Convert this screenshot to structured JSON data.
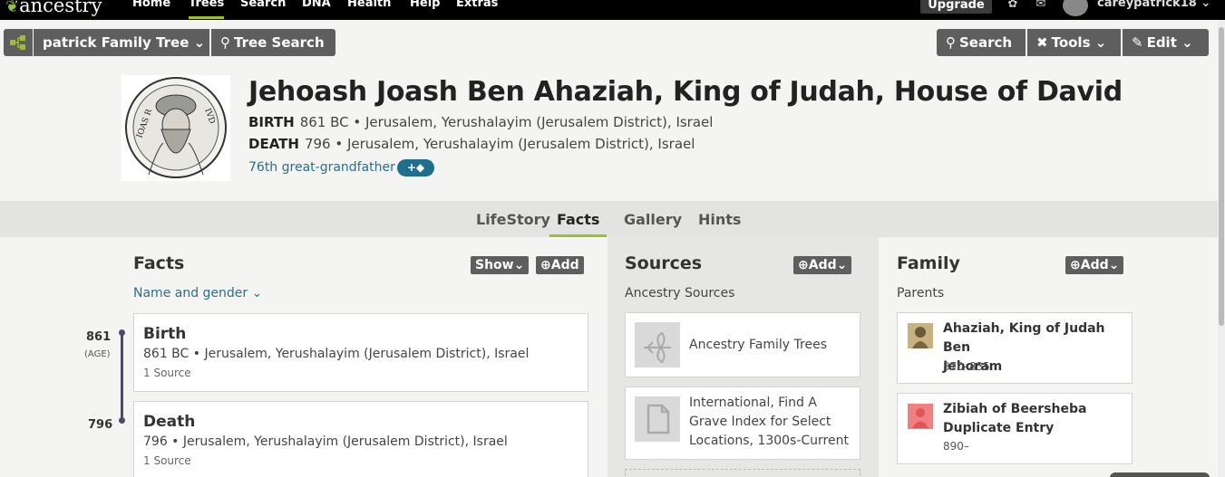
{
  "topnav": {
    "logo": "ancestry",
    "items": [
      "Home",
      "Trees",
      "Search",
      "DNA",
      "Health",
      "Help",
      "Extras"
    ],
    "active": "Trees",
    "upgrade": "Upgrade",
    "username": "careypatrick18"
  },
  "toolbar": {
    "tree_name": "patrick Family Tree",
    "tree_search": "Tree Search",
    "search": "Search",
    "tools": "Tools",
    "edit": "Edit"
  },
  "person": {
    "name": "Jehoash Joash Ben Ahaziah, King of Judah, House of David",
    "birth_label": "BIRTH",
    "birth_value": "861 BC • Jerusalem, Yerushalayim (Jerusalem District), Israel",
    "death_label": "DEATH",
    "death_value": "796 • Jerusalem, Yerushalayim (Jerusalem District), Israel",
    "relation": "76th great-grandfather",
    "portrait_inscription_left": "IOAS R",
    "portrait_inscription_right": "IVD"
  },
  "tabs": [
    "LifeStory",
    "Facts",
    "Gallery",
    "Hints"
  ],
  "active_tab": "Facts",
  "facts": {
    "title": "Facts",
    "show": "Show",
    "add": "Add",
    "filter": "Name and gender",
    "items": [
      {
        "year": "861",
        "age": "(AGE)",
        "title": "Birth",
        "detail": "861 BC • Jerusalem, Yerushalayim (Jerusalem District), Israel",
        "sources": "1 Source"
      },
      {
        "year": "796",
        "age": "",
        "title": "Death",
        "detail": "796 • Jerusalem, Yerushalayim (Jerusalem District), Israel",
        "sources": "1 Source"
      }
    ]
  },
  "sources": {
    "title": "Sources",
    "add": "Add",
    "subtitle": "Ancestry Sources",
    "items": [
      {
        "text": "Ancestry Family Trees"
      },
      {
        "text_lines": [
          "International, Find A",
          "Grave Index for Select",
          "Locations, 1300s-Current"
        ]
      }
    ]
  },
  "family": {
    "title": "Family",
    "add": "Add",
    "subtitle": "Parents",
    "members": [
      {
        "name_lines": [
          "Ahaziah, King of Judah Ben",
          "Jehoram"
        ],
        "dates": "870–835"
      },
      {
        "name_lines": [
          "Zibiah of Beersheba",
          "Duplicate Entry"
        ],
        "dates": "890–"
      }
    ]
  },
  "colors": {
    "accent_green": "#9cbe30",
    "link_blue": "#2a6f8e",
    "button_gray": "#5e5e5e",
    "female_pink": "#f08080"
  }
}
